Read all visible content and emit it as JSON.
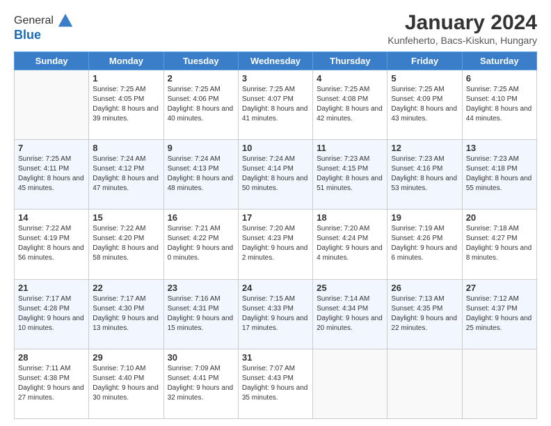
{
  "header": {
    "logo": {
      "line1": "General",
      "line2": "Blue"
    },
    "title": "January 2024",
    "subtitle": "Kunfeherto, Bacs-Kiskun, Hungary"
  },
  "calendar": {
    "weekdays": [
      "Sunday",
      "Monday",
      "Tuesday",
      "Wednesday",
      "Thursday",
      "Friday",
      "Saturday"
    ],
    "weeks": [
      [
        {
          "day": "",
          "sunrise": "",
          "sunset": "",
          "daylight": ""
        },
        {
          "day": "1",
          "sunrise": "Sunrise: 7:25 AM",
          "sunset": "Sunset: 4:05 PM",
          "daylight": "Daylight: 8 hours and 39 minutes."
        },
        {
          "day": "2",
          "sunrise": "Sunrise: 7:25 AM",
          "sunset": "Sunset: 4:06 PM",
          "daylight": "Daylight: 8 hours and 40 minutes."
        },
        {
          "day": "3",
          "sunrise": "Sunrise: 7:25 AM",
          "sunset": "Sunset: 4:07 PM",
          "daylight": "Daylight: 8 hours and 41 minutes."
        },
        {
          "day": "4",
          "sunrise": "Sunrise: 7:25 AM",
          "sunset": "Sunset: 4:08 PM",
          "daylight": "Daylight: 8 hours and 42 minutes."
        },
        {
          "day": "5",
          "sunrise": "Sunrise: 7:25 AM",
          "sunset": "Sunset: 4:09 PM",
          "daylight": "Daylight: 8 hours and 43 minutes."
        },
        {
          "day": "6",
          "sunrise": "Sunrise: 7:25 AM",
          "sunset": "Sunset: 4:10 PM",
          "daylight": "Daylight: 8 hours and 44 minutes."
        }
      ],
      [
        {
          "day": "7",
          "sunrise": "Sunrise: 7:25 AM",
          "sunset": "Sunset: 4:11 PM",
          "daylight": "Daylight: 8 hours and 45 minutes."
        },
        {
          "day": "8",
          "sunrise": "Sunrise: 7:24 AM",
          "sunset": "Sunset: 4:12 PM",
          "daylight": "Daylight: 8 hours and 47 minutes."
        },
        {
          "day": "9",
          "sunrise": "Sunrise: 7:24 AM",
          "sunset": "Sunset: 4:13 PM",
          "daylight": "Daylight: 8 hours and 48 minutes."
        },
        {
          "day": "10",
          "sunrise": "Sunrise: 7:24 AM",
          "sunset": "Sunset: 4:14 PM",
          "daylight": "Daylight: 8 hours and 50 minutes."
        },
        {
          "day": "11",
          "sunrise": "Sunrise: 7:23 AM",
          "sunset": "Sunset: 4:15 PM",
          "daylight": "Daylight: 8 hours and 51 minutes."
        },
        {
          "day": "12",
          "sunrise": "Sunrise: 7:23 AM",
          "sunset": "Sunset: 4:16 PM",
          "daylight": "Daylight: 8 hours and 53 minutes."
        },
        {
          "day": "13",
          "sunrise": "Sunrise: 7:23 AM",
          "sunset": "Sunset: 4:18 PM",
          "daylight": "Daylight: 8 hours and 55 minutes."
        }
      ],
      [
        {
          "day": "14",
          "sunrise": "Sunrise: 7:22 AM",
          "sunset": "Sunset: 4:19 PM",
          "daylight": "Daylight: 8 hours and 56 minutes."
        },
        {
          "day": "15",
          "sunrise": "Sunrise: 7:22 AM",
          "sunset": "Sunset: 4:20 PM",
          "daylight": "Daylight: 8 hours and 58 minutes."
        },
        {
          "day": "16",
          "sunrise": "Sunrise: 7:21 AM",
          "sunset": "Sunset: 4:22 PM",
          "daylight": "Daylight: 9 hours and 0 minutes."
        },
        {
          "day": "17",
          "sunrise": "Sunrise: 7:20 AM",
          "sunset": "Sunset: 4:23 PM",
          "daylight": "Daylight: 9 hours and 2 minutes."
        },
        {
          "day": "18",
          "sunrise": "Sunrise: 7:20 AM",
          "sunset": "Sunset: 4:24 PM",
          "daylight": "Daylight: 9 hours and 4 minutes."
        },
        {
          "day": "19",
          "sunrise": "Sunrise: 7:19 AM",
          "sunset": "Sunset: 4:26 PM",
          "daylight": "Daylight: 9 hours and 6 minutes."
        },
        {
          "day": "20",
          "sunrise": "Sunrise: 7:18 AM",
          "sunset": "Sunset: 4:27 PM",
          "daylight": "Daylight: 9 hours and 8 minutes."
        }
      ],
      [
        {
          "day": "21",
          "sunrise": "Sunrise: 7:17 AM",
          "sunset": "Sunset: 4:28 PM",
          "daylight": "Daylight: 9 hours and 10 minutes."
        },
        {
          "day": "22",
          "sunrise": "Sunrise: 7:17 AM",
          "sunset": "Sunset: 4:30 PM",
          "daylight": "Daylight: 9 hours and 13 minutes."
        },
        {
          "day": "23",
          "sunrise": "Sunrise: 7:16 AM",
          "sunset": "Sunset: 4:31 PM",
          "daylight": "Daylight: 9 hours and 15 minutes."
        },
        {
          "day": "24",
          "sunrise": "Sunrise: 7:15 AM",
          "sunset": "Sunset: 4:33 PM",
          "daylight": "Daylight: 9 hours and 17 minutes."
        },
        {
          "day": "25",
          "sunrise": "Sunrise: 7:14 AM",
          "sunset": "Sunset: 4:34 PM",
          "daylight": "Daylight: 9 hours and 20 minutes."
        },
        {
          "day": "26",
          "sunrise": "Sunrise: 7:13 AM",
          "sunset": "Sunset: 4:35 PM",
          "daylight": "Daylight: 9 hours and 22 minutes."
        },
        {
          "day": "27",
          "sunrise": "Sunrise: 7:12 AM",
          "sunset": "Sunset: 4:37 PM",
          "daylight": "Daylight: 9 hours and 25 minutes."
        }
      ],
      [
        {
          "day": "28",
          "sunrise": "Sunrise: 7:11 AM",
          "sunset": "Sunset: 4:38 PM",
          "daylight": "Daylight: 9 hours and 27 minutes."
        },
        {
          "day": "29",
          "sunrise": "Sunrise: 7:10 AM",
          "sunset": "Sunset: 4:40 PM",
          "daylight": "Daylight: 9 hours and 30 minutes."
        },
        {
          "day": "30",
          "sunrise": "Sunrise: 7:09 AM",
          "sunset": "Sunset: 4:41 PM",
          "daylight": "Daylight: 9 hours and 32 minutes."
        },
        {
          "day": "31",
          "sunrise": "Sunrise: 7:07 AM",
          "sunset": "Sunset: 4:43 PM",
          "daylight": "Daylight: 9 hours and 35 minutes."
        },
        {
          "day": "",
          "sunrise": "",
          "sunset": "",
          "daylight": ""
        },
        {
          "day": "",
          "sunrise": "",
          "sunset": "",
          "daylight": ""
        },
        {
          "day": "",
          "sunrise": "",
          "sunset": "",
          "daylight": ""
        }
      ]
    ]
  }
}
